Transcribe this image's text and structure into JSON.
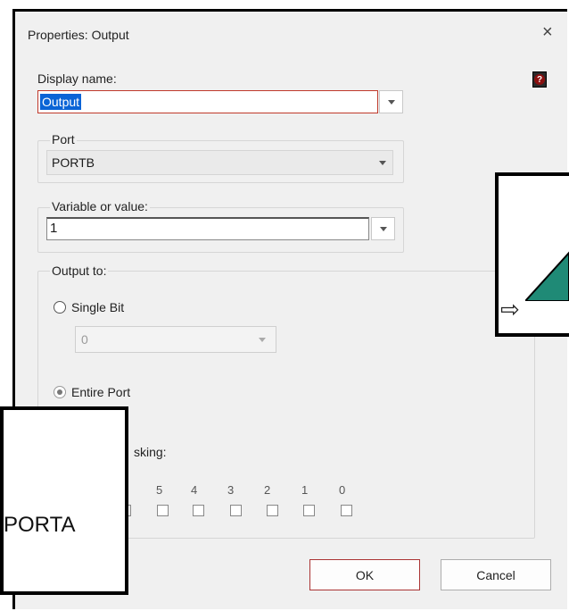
{
  "dialog": {
    "title": "Properties: Output",
    "close_glyph": "×",
    "help_glyph": "?"
  },
  "display_name": {
    "label": "Display name:",
    "value": "Output"
  },
  "port": {
    "legend": "Port",
    "value": "PORTB"
  },
  "variable": {
    "legend": "Variable or value:",
    "value": "1"
  },
  "output_to": {
    "legend": "Output to:",
    "single_bit": {
      "label": "Single Bit",
      "selected": false,
      "value": "0"
    },
    "entire_port": {
      "label": "Entire Port",
      "selected": true
    },
    "masking_label": "sking:",
    "bits": [
      "5",
      "4",
      "3",
      "2",
      "1",
      "0"
    ]
  },
  "buttons": {
    "ok": "OK",
    "cancel": "Cancel"
  },
  "overlays": {
    "zoom_label": "PORTA",
    "arrow_glyph": "⇨"
  },
  "colors": {
    "accent_red": "#c0392b",
    "selection_blue": "#0a64d6",
    "teal": "#1f8a76"
  }
}
